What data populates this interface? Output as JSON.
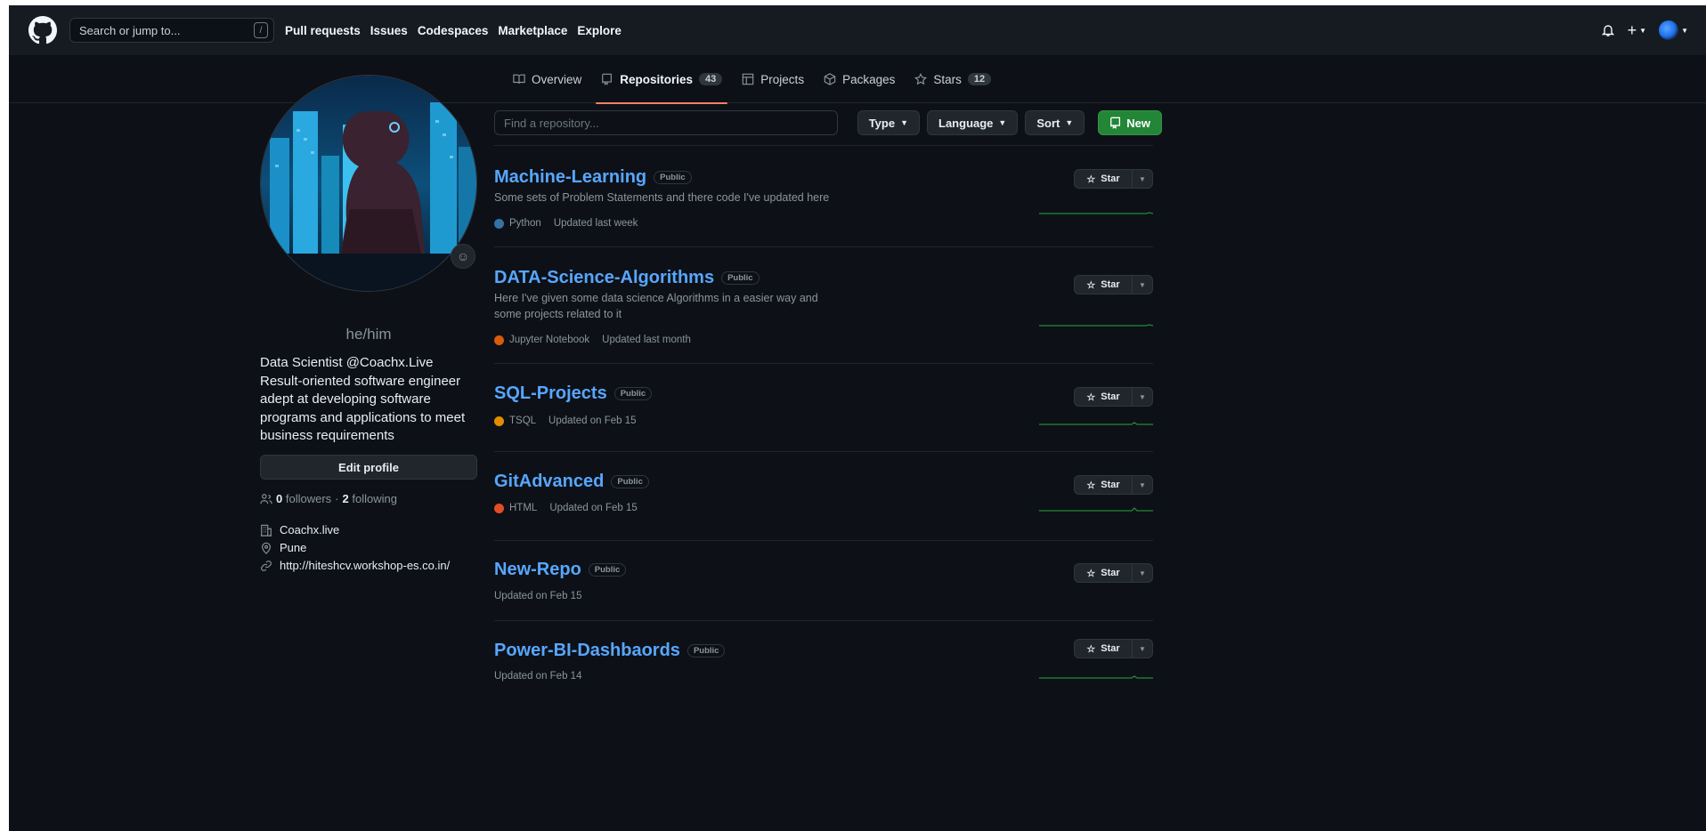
{
  "header": {
    "search_placeholder": "Search or jump to...",
    "search_shortcut": "/",
    "nav": [
      "Pull requests",
      "Issues",
      "Codespaces",
      "Marketplace",
      "Explore"
    ],
    "icons": [
      "bell-icon",
      "plus-icon",
      "caret-down-icon",
      "avatar"
    ]
  },
  "tabs": [
    {
      "label": "Overview",
      "icon": "book-icon"
    },
    {
      "label": "Repositories",
      "icon": "repo-icon",
      "count": "43",
      "selected": true
    },
    {
      "label": "Projects",
      "icon": "table-icon"
    },
    {
      "label": "Packages",
      "icon": "package-icon"
    },
    {
      "label": "Stars",
      "icon": "star-icon",
      "count": "12"
    }
  ],
  "profile": {
    "pronouns": "he/him",
    "bio": "Data Scientist @Coachx.Live Result-oriented software engineer adept at developing software programs and applications to meet business requirements",
    "edit_label": "Edit profile",
    "followers_count": "0",
    "followers_label": "followers",
    "sep": "·",
    "following_count": "2",
    "following_label": "following",
    "company": "Coachx.live",
    "location": "Pune",
    "website": "http://hiteshcv.workshop-es.co.in/"
  },
  "filters": {
    "find_placeholder": "Find a repository...",
    "type_label": "Type",
    "language_label": "Language",
    "sort_label": "Sort",
    "new_label": "New"
  },
  "star_label": "Star",
  "repos": [
    {
      "name": "Machine-Learning",
      "visibility": "Public",
      "description": "Some sets of Problem Statements and there code I've updated here",
      "language": "Python",
      "language_color": "#3572A5",
      "updated": "Updated last week"
    },
    {
      "name": "DATA-Science-Algorithms",
      "visibility": "Public",
      "description": "Here I've given some data science Algorithms in a easier way and some projects related to it",
      "language": "Jupyter Notebook",
      "language_color": "#DA5B0B",
      "updated": "Updated last month"
    },
    {
      "name": "SQL-Projects",
      "visibility": "Public",
      "description": "",
      "language": "TSQL",
      "language_color": "#e38c00",
      "updated": "Updated on Feb 15"
    },
    {
      "name": "GitAdvanced",
      "visibility": "Public",
      "description": "",
      "language": "HTML",
      "language_color": "#e34c26",
      "updated": "Updated on Feb 15"
    },
    {
      "name": "New-Repo",
      "visibility": "Public",
      "description": "",
      "language": "",
      "language_color": "",
      "updated": "Updated on Feb 15"
    },
    {
      "name": "Power-BI-Dashbaords",
      "visibility": "Public",
      "description": "",
      "language": "",
      "language_color": "",
      "updated": "Updated on Feb 14"
    }
  ],
  "colors": {
    "bg": "#0d1117",
    "header": "#161b22",
    "link": "#58a6ff",
    "accent": "#238636",
    "tab_underline": "#f78166"
  }
}
